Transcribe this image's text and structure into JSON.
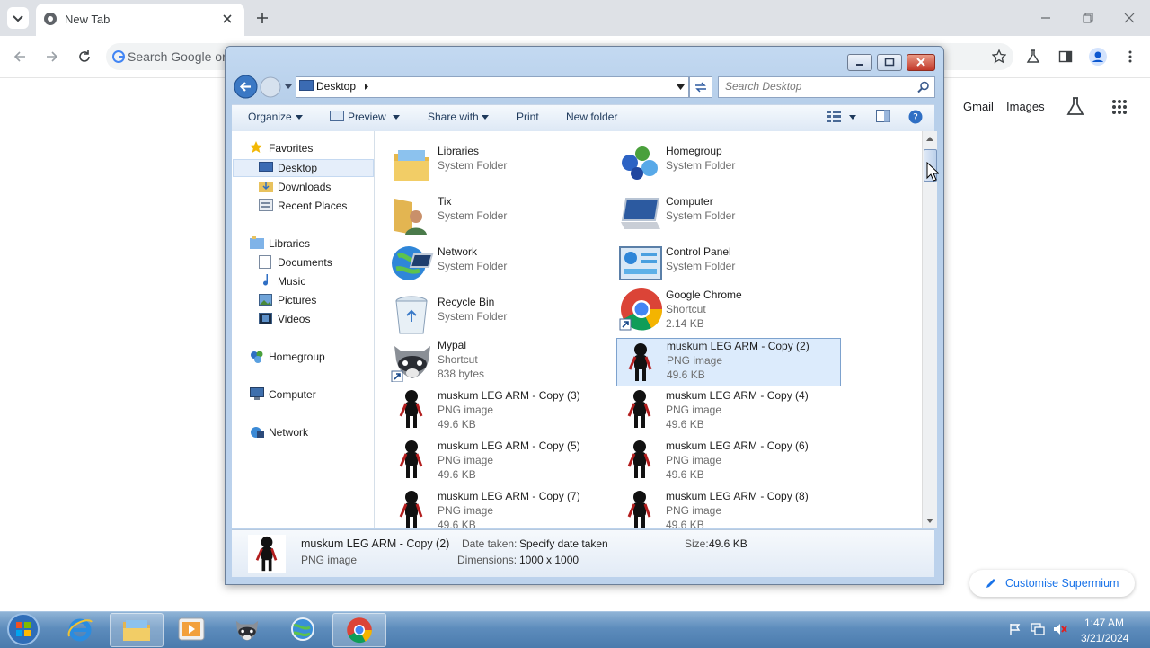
{
  "browser": {
    "tab_title": "New Tab",
    "omnibox_placeholder": "Search Google or type a URL",
    "links": {
      "gmail": "Gmail",
      "images": "Images"
    },
    "customise_label": "Customise Supermium"
  },
  "explorer": {
    "address": "Desktop",
    "search_placeholder": "Search Desktop",
    "toolbar": {
      "organize": "Organize",
      "preview": "Preview",
      "share_with": "Share with",
      "print": "Print",
      "new_folder": "New folder"
    },
    "nav": {
      "favorites": "Favorites",
      "desktop": "Desktop",
      "downloads": "Downloads",
      "recent_places": "Recent Places",
      "libraries": "Libraries",
      "documents": "Documents",
      "music": "Music",
      "pictures": "Pictures",
      "videos": "Videos",
      "homegroup": "Homegroup",
      "computer": "Computer",
      "network": "Network"
    },
    "items": [
      {
        "name": "Libraries",
        "type": "System Folder",
        "size": "",
        "icon": "libraries-icon"
      },
      {
        "name": "Homegroup",
        "type": "System Folder",
        "size": "",
        "icon": "homegroup-icon"
      },
      {
        "name": "Tix",
        "type": "System Folder",
        "size": "",
        "icon": "user-folder-icon"
      },
      {
        "name": "Computer",
        "type": "System Folder",
        "size": "",
        "icon": "computer-icon"
      },
      {
        "name": "Network",
        "type": "System Folder",
        "size": "",
        "icon": "network-icon"
      },
      {
        "name": "Control Panel",
        "type": "System Folder",
        "size": "",
        "icon": "control-panel-icon"
      },
      {
        "name": "Recycle Bin",
        "type": "System Folder",
        "size": "",
        "icon": "recycle-bin-icon"
      },
      {
        "name": "Google Chrome",
        "type": "Shortcut",
        "size": "2.14 KB",
        "icon": "chrome-icon"
      },
      {
        "name": "Mypal",
        "type": "Shortcut",
        "size": "838 bytes",
        "icon": "raccoon-icon"
      },
      {
        "name": "muskum LEG ARM - Copy (2)",
        "type": "PNG image",
        "size": "49.6 KB",
        "icon": "figure-icon"
      },
      {
        "name": "muskum LEG ARM - Copy (3)",
        "type": "PNG image",
        "size": "49.6 KB",
        "icon": "figure-icon"
      },
      {
        "name": "muskum LEG ARM - Copy (4)",
        "type": "PNG image",
        "size": "49.6 KB",
        "icon": "figure-icon"
      },
      {
        "name": "muskum LEG ARM - Copy (5)",
        "type": "PNG image",
        "size": "49.6 KB",
        "icon": "figure-icon"
      },
      {
        "name": "muskum LEG ARM - Copy (6)",
        "type": "PNG image",
        "size": "49.6 KB",
        "icon": "figure-icon"
      },
      {
        "name": "muskum LEG ARM - Copy (7)",
        "type": "PNG image",
        "size": "49.6 KB",
        "icon": "figure-icon"
      },
      {
        "name": "muskum LEG ARM - Copy (8)",
        "type": "PNG image",
        "size": "49.6 KB",
        "icon": "figure-icon"
      }
    ],
    "details": {
      "name": "muskum LEG ARM - Copy (2)",
      "type": "PNG image",
      "date_label": "Date taken:",
      "date_value": "Specify date taken",
      "size_label": "Size:",
      "size_value": "49.6 KB",
      "dim_label": "Dimensions:",
      "dim_value": "1000 x 1000"
    }
  },
  "taskbar": {
    "time": "1:47 AM",
    "date": "3/21/2024"
  },
  "colors": {
    "selection": "#dcebfc",
    "taskbar": "#5d8cbc",
    "accent": "#1a73e8"
  }
}
